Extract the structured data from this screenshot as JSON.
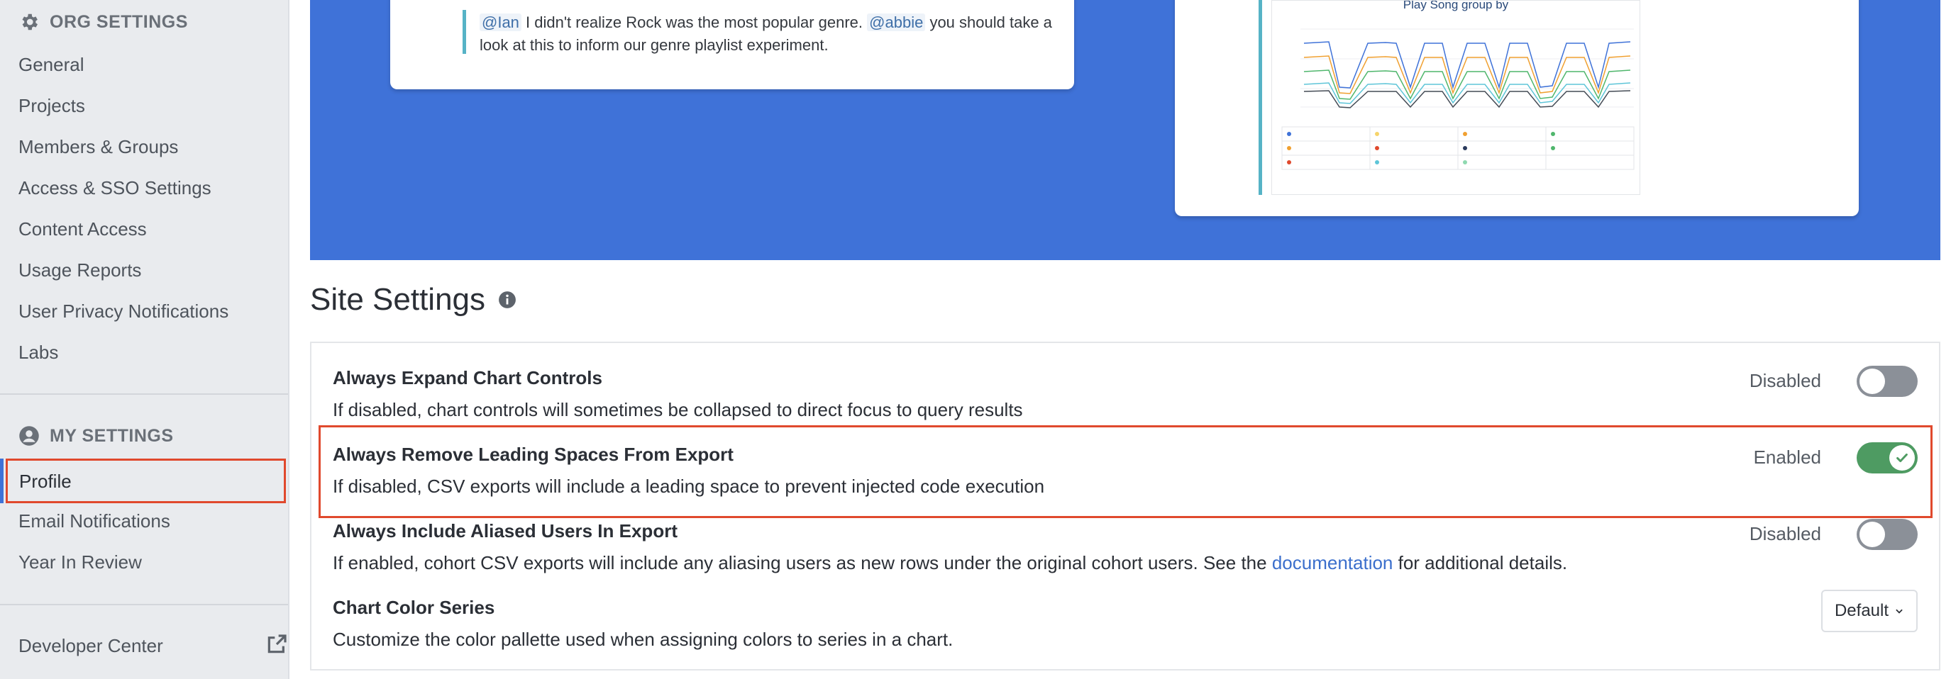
{
  "sidebar": {
    "org_settings_title": "ORG SETTINGS",
    "org_items": [
      "General",
      "Projects",
      "Members & Groups",
      "Access & SSO Settings",
      "Content Access",
      "Usage Reports",
      "User Privacy Notifications",
      "Labs"
    ],
    "my_settings_title": "MY SETTINGS",
    "my_items": [
      "Profile",
      "Email Notifications",
      "Year In Review"
    ],
    "developer_center": "Developer Center"
  },
  "hero": {
    "comment": {
      "mention1": "@Ian",
      "text1": " I didn't realize Rock was the most popular genre. ",
      "mention2": "@abbie",
      "text2": " you should take a look at this to inform our genre playlist experiment."
    },
    "chart_title": "Play Song group by"
  },
  "site_settings": {
    "title": "Site Settings",
    "rows": [
      {
        "title": "Always Expand Chart Controls",
        "description": "If disabled, chart controls will sometimes be collapsed to direct focus to query results",
        "status": "Disabled",
        "enabled": false
      },
      {
        "title": "Always Remove Leading Spaces From Export",
        "description": "If disabled, CSV exports will include a leading space to prevent injected code execution",
        "status": "Enabled",
        "enabled": true
      },
      {
        "title": "Always Include Aliased Users In Export",
        "description_prefix": "If enabled, cohort CSV exports will include any aliasing users as new rows under the original cohort users. See the ",
        "description_link": "documentation",
        "description_suffix": " for additional details.",
        "status": "Disabled",
        "enabled": false
      },
      {
        "title": "Chart Color Series",
        "description": "Customize the color pallette used when assigning colors to series in a chart.",
        "select_value": "Default"
      }
    ]
  },
  "colors": {
    "accent_blue": "#3f72d8",
    "highlight_red": "#e0492d",
    "toggle_on": "#4e9b62",
    "toggle_off": "#8b9098"
  }
}
